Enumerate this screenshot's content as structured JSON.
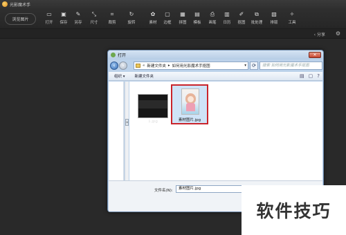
{
  "app": {
    "title": "光影魔术手"
  },
  "toolbar": {
    "browse_label": "浏览图片",
    "tools": [
      {
        "icon": "open-folder",
        "label": "打开"
      },
      {
        "icon": "save",
        "label": "保存"
      },
      {
        "icon": "save-as",
        "label": "另存"
      },
      {
        "icon": "resize",
        "label": "尺寸"
      },
      {
        "icon": "crop",
        "label": "裁剪"
      },
      {
        "icon": "rotate",
        "label": "旋转"
      },
      {
        "icon": "material",
        "label": "素材"
      },
      {
        "icon": "border",
        "label": "边框"
      },
      {
        "icon": "collage",
        "label": "拼图"
      },
      {
        "icon": "template",
        "label": "模板"
      },
      {
        "icon": "print",
        "label": "画笔"
      },
      {
        "icon": "calendar",
        "label": "日历"
      },
      {
        "icon": "brush",
        "label": "抠图"
      },
      {
        "icon": "batch",
        "label": "批处理"
      },
      {
        "icon": "layout",
        "label": "排版"
      },
      {
        "icon": "wrench",
        "label": "工具"
      }
    ],
    "share_label": "分享"
  },
  "dialog": {
    "title": "打开",
    "breadcrumb": [
      "新建文件夹",
      "如何用光影魔术手抠图"
    ],
    "search_placeholder": "搜索 如何用光影魔术手抠图",
    "organize": "组织 ▾",
    "new_folder": "新建文件夹",
    "files": [
      {
        "name": "1.jpg",
        "selected": false
      },
      {
        "name": "素材图片.jpg",
        "selected": true
      }
    ],
    "filename_label": "文件名(N):",
    "filename_value": "素材图片.jpg"
  },
  "watermark": "软件技巧"
}
